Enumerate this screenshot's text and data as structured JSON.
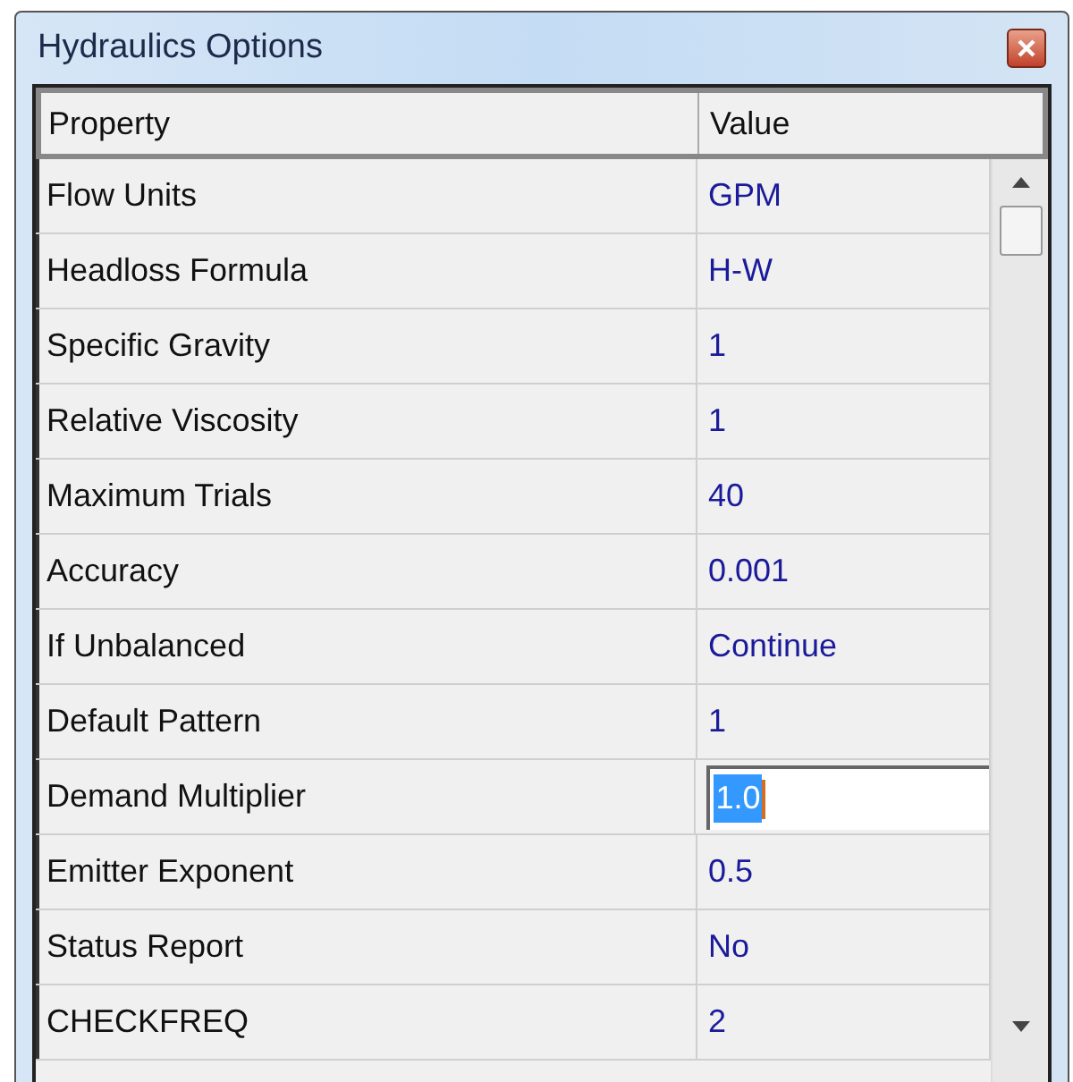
{
  "window": {
    "title": "Hydraulics Options"
  },
  "table": {
    "columns": [
      "Property",
      "Value"
    ],
    "rows": [
      {
        "property": "Flow Units",
        "value": "GPM",
        "kind": "text"
      },
      {
        "property": "Headloss Formula",
        "value": "H-W",
        "kind": "text"
      },
      {
        "property": "Specific Gravity",
        "value": "1",
        "kind": "text"
      },
      {
        "property": "Relative Viscosity",
        "value": "1",
        "kind": "text"
      },
      {
        "property": "Maximum Trials",
        "value": "40",
        "kind": "text"
      },
      {
        "property": "Accuracy",
        "value": "0.001",
        "kind": "text"
      },
      {
        "property": "If Unbalanced",
        "value": "Continue",
        "kind": "text"
      },
      {
        "property": "Default Pattern",
        "value": "1",
        "kind": "text"
      },
      {
        "property": "Demand Multiplier",
        "value": "1.0",
        "kind": "input"
      },
      {
        "property": "Emitter Exponent",
        "value": "0.5",
        "kind": "text"
      },
      {
        "property": "Status Report",
        "value": "No",
        "kind": "text"
      },
      {
        "property": "CHECKFREQ",
        "value": "2",
        "kind": "text"
      }
    ]
  }
}
